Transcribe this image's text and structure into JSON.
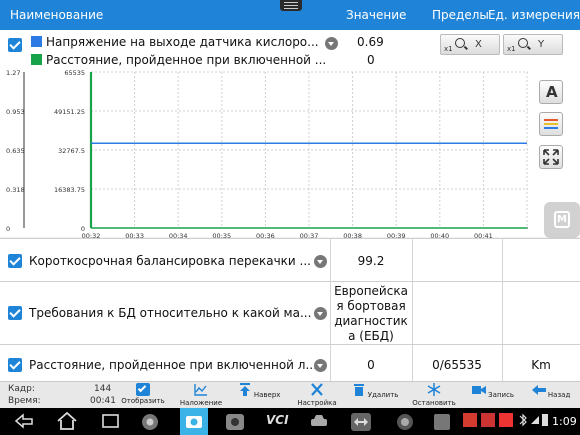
{
  "header": {
    "col_name": "Наименование",
    "col_value": "Значение",
    "col_limits": "Пределы",
    "col_unit": "Ед. измерения"
  },
  "graph": {
    "params": [
      {
        "name": "Напряжение на выходе датчика кислоро...",
        "value": "0.69",
        "color": "#2c7be5"
      },
      {
        "name": "Расстояние, пройденное при включенной ...",
        "value": "0",
        "color": "#17a34a"
      }
    ],
    "zoom_x": {
      "label": "X",
      "sub": "x1"
    },
    "zoom_y": {
      "label": "Y",
      "sub": "x1"
    },
    "side_btn_text": "A",
    "side_btn_m": "M"
  },
  "chart_data": {
    "type": "line",
    "left_axis_ticks": [
      "1.27",
      "0.953",
      "0.635",
      "0.318",
      "0"
    ],
    "right_axis_ticks": [
      "65535",
      "49151.25",
      "32767.5",
      "16383.75",
      "0"
    ],
    "x_ticks": [
      "00:32",
      "00:33",
      "00:34",
      "00:35",
      "00:36",
      "00:37",
      "00:38",
      "00:39",
      "00:40",
      "00:41"
    ],
    "series": [
      {
        "name": "Напряжение на выходе датчика кислоро...",
        "color": "#2c7be5",
        "x": [
          "00:32",
          "00:33",
          "00:34",
          "00:35",
          "00:36",
          "00:37",
          "00:38",
          "00:39",
          "00:40",
          "00:41",
          "00:42"
        ],
        "values": [
          0.69,
          0.69,
          0.69,
          0.69,
          0.69,
          0.69,
          0.69,
          0.69,
          0.69,
          0.69,
          0.69
        ]
      },
      {
        "name": "Расстояние, пройденное при включенной ...",
        "color": "#17a34a",
        "x": [
          "00:32",
          "00:42"
        ],
        "values": [
          0,
          0
        ]
      }
    ],
    "ylim_left": [
      0,
      1.27
    ],
    "ylim_right": [
      0,
      65535
    ],
    "grid": true
  },
  "rows": [
    {
      "name": "Короткосрочная балансировка перекачки ...",
      "value": "99.2",
      "limits": "",
      "unit": ""
    },
    {
      "name": "Требования к БД относительно к какой ма...",
      "value": "Европейска я бортовая диагностик а (ЕБД)",
      "value_lines": [
        "Европейска",
        "я бортовая",
        "диагностик",
        "а (ЕБД)"
      ],
      "limits": "",
      "unit": ""
    },
    {
      "name": "Расстояние, пройденное при включенной л...",
      "value": "0",
      "limits": "0/65535",
      "unit": "Km"
    }
  ],
  "toolbar": {
    "frame_label": "Кадр:",
    "frame_value": "144",
    "time_label": "Время:",
    "time_value": "00:41",
    "buttons": [
      "Отобразить",
      "Наложение",
      "Наверх",
      "Настройка",
      "Удалить",
      "Остановить",
      "Запись",
      "Назад"
    ]
  },
  "navbar": {
    "clock": "1:09",
    "vci": "VCI"
  }
}
